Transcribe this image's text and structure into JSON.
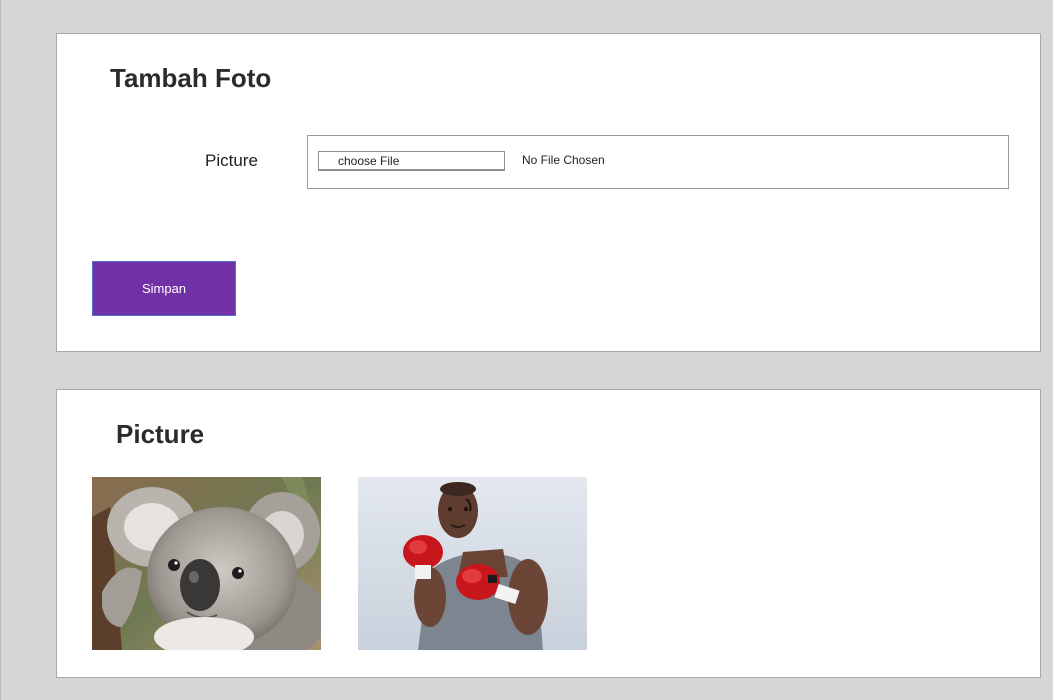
{
  "upload_panel": {
    "title": "Tambah Foto",
    "field_label": "Picture",
    "choose_button_label": "choose File",
    "file_status": "No File Chosen",
    "save_button_label": "Simpan"
  },
  "gallery_panel": {
    "title": "Picture",
    "photos": [
      {
        "subject": "koala"
      },
      {
        "subject": "boxer"
      }
    ]
  },
  "colors": {
    "background": "#d6d6d6",
    "panel": "#ffffff",
    "save_button": "#7130a6"
  }
}
